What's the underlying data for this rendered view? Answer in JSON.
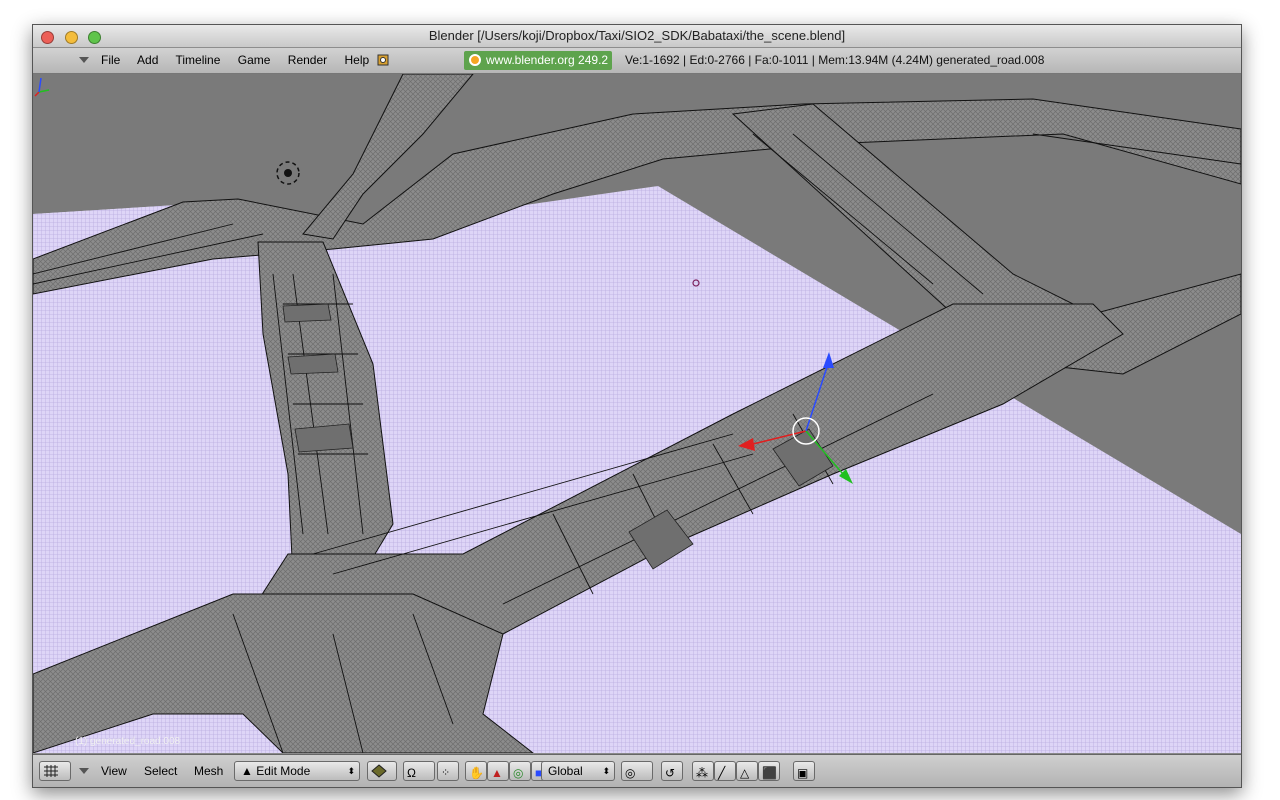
{
  "window": {
    "title": "Blender [/Users/koji/Dropbox/Taxi/SIO2_SDK/Babataxi/the_scene.blend]"
  },
  "menubar": {
    "items": [
      "File",
      "Add",
      "Timeline",
      "Game",
      "Render",
      "Help"
    ],
    "badge": "www.blender.org 249.2",
    "stats": "Ve:1-1692 | Ed:0-2766 | Fa:0-1011 | Mem:13.94M (4.24M) generated_road.008"
  },
  "viewport": {
    "object_label": "(1) generated_road.008"
  },
  "bottombar": {
    "view": "View",
    "select": "Select",
    "mesh": "Mesh",
    "mode": "Edit Mode",
    "orientation": "Global"
  },
  "colors": {
    "ground": "#d9cff5",
    "road": "#8a8a8a",
    "gizmo_x": "#e02020",
    "gizmo_y": "#20c020",
    "gizmo_z": "#2a4bff"
  }
}
